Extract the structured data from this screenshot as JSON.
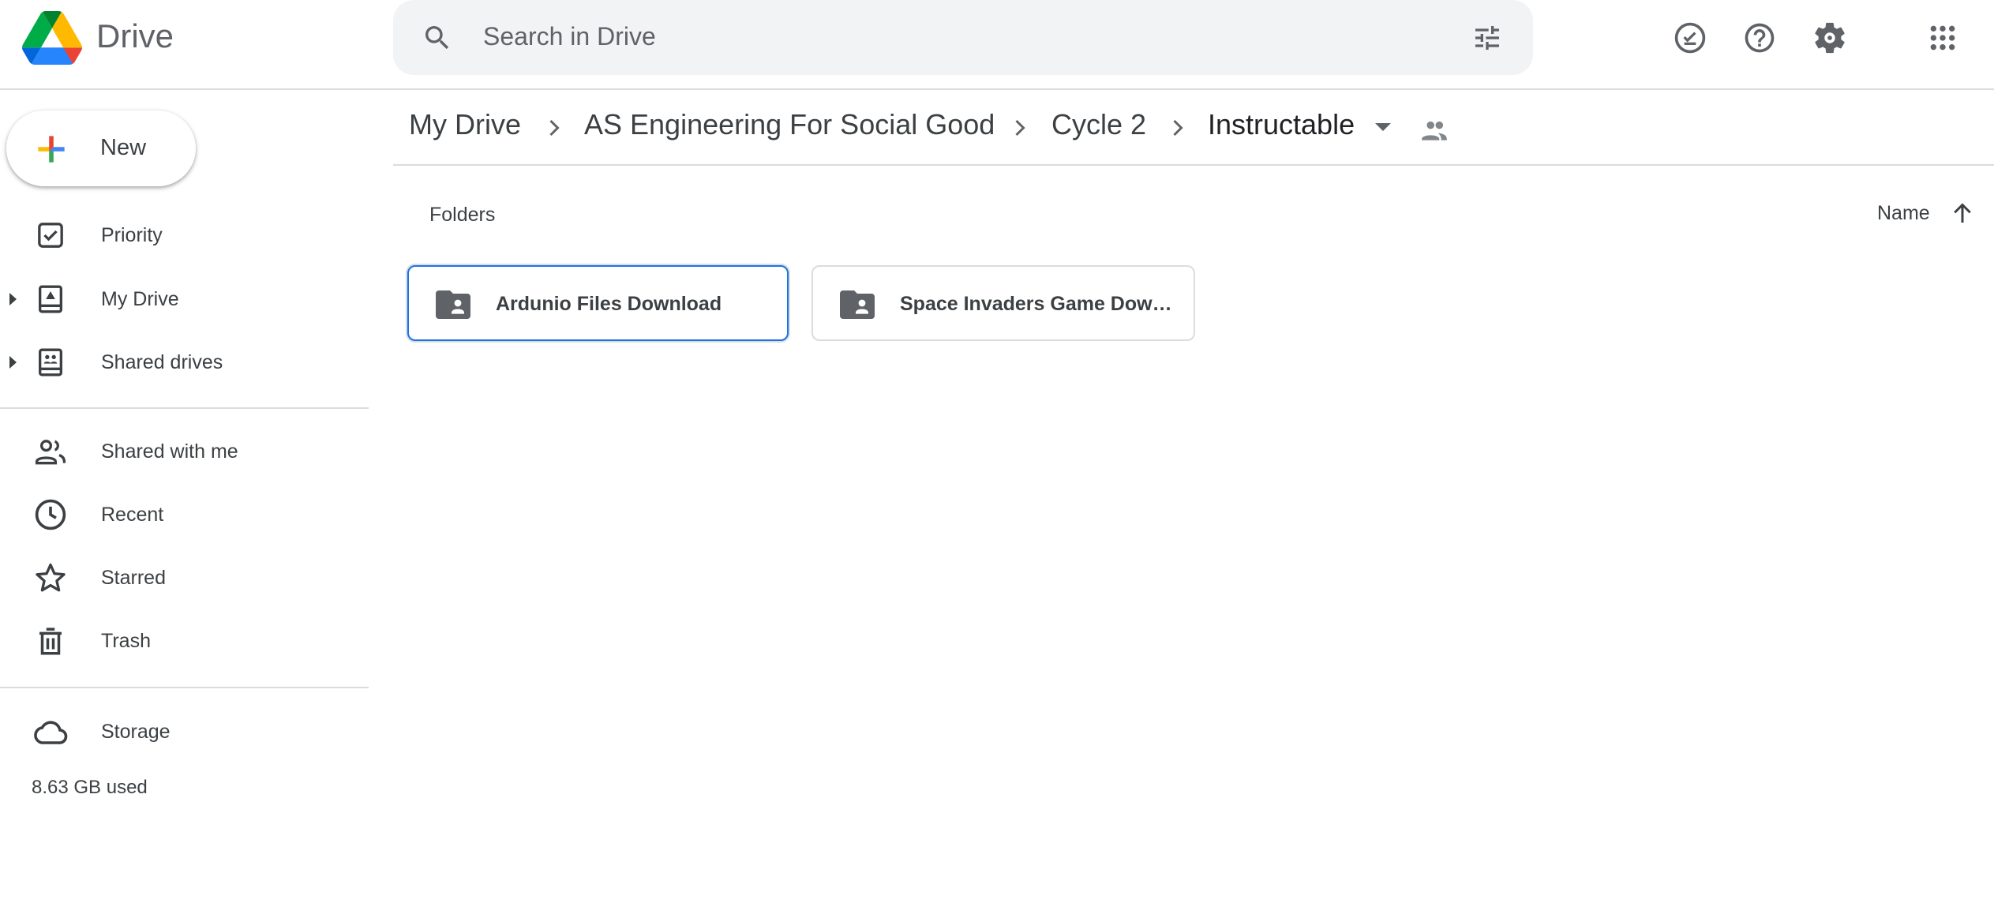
{
  "header": {
    "app_title": "Drive",
    "search_placeholder": "Search in Drive",
    "icons": [
      "drive-logo",
      "search-icon",
      "tune-icon",
      "ready-for-offline-icon",
      "help-icon",
      "settings-icon",
      "apps-icon"
    ]
  },
  "sidebar": {
    "new_label": "New",
    "items": [
      {
        "label": "Priority",
        "icon": "priority-icon"
      },
      {
        "label": "My Drive",
        "icon": "my-drive-icon"
      },
      {
        "label": "Shared drives",
        "icon": "shared-drives-icon"
      },
      {
        "label": "Shared with me",
        "icon": "people-icon"
      },
      {
        "label": "Recent",
        "icon": "clock-icon"
      },
      {
        "label": "Starred",
        "icon": "star-icon"
      },
      {
        "label": "Trash",
        "icon": "trash-icon"
      },
      {
        "label": "Storage",
        "icon": "cloud-icon"
      }
    ],
    "storage_used": "8.63 GB used"
  },
  "breadcrumb": [
    "My Drive",
    "AS Engineering For Social Good",
    "Cycle 2",
    "Instructable"
  ],
  "main": {
    "section_label": "Folders",
    "sort_label": "Name",
    "folders": [
      {
        "name": "Ardunio Files Download",
        "selected": true
      },
      {
        "name": "Space Invaders Game Download",
        "selected": false
      }
    ]
  },
  "colors": {
    "accent": "#1a73e8",
    "icon": "#5f6368",
    "search_bg": "#f1f3f4"
  }
}
